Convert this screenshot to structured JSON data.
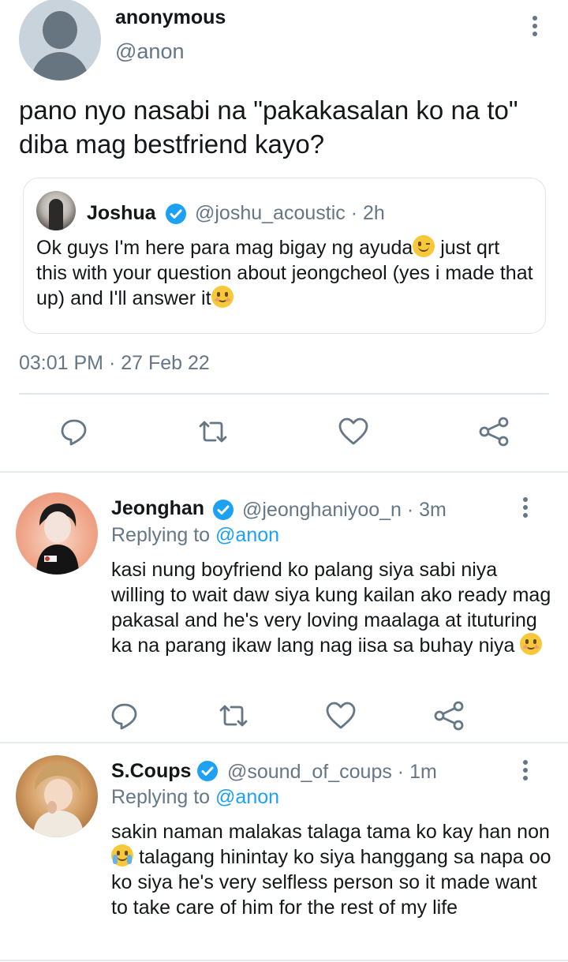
{
  "main_tweet": {
    "author_name": "anonymous",
    "author_handle": "@anon",
    "text": "pano nyo nasabi na \"pakakasalan ko na to\" diba mag bestfriend kayo?",
    "timestamp": "03:01 PM · 27 Feb 22",
    "quoted": {
      "name": "Joshua",
      "handle_time": "@joshu_acoustic · 2h",
      "text_part1": "Ok guys I'm here para mag bigay ng ayuda",
      "text_part2": " just qrt this with your question about jeongcheol (yes i made that up) and I'll answer it"
    }
  },
  "replies": [
    {
      "name": "Jeonghan",
      "handle_time": "@jeonghaniyoo_n · 3m",
      "replying_prefix": "Replying to ",
      "replying_mention": "@anon",
      "text": "kasi nung boyfriend ko palang siya sabi niya willing to wait daw siya kung kailan ako ready mag pakasal and he's very loving maalaga at ituturing ka na parang ikaw lang nag iisa sa buhay niya "
    },
    {
      "name": "S.Coups",
      "handle_time": "@sound_of_coups · 1m",
      "replying_prefix": "Replying to ",
      "replying_mention": "@anon",
      "text_part1": "sakin naman malakas talaga tama ko kay han non",
      "text_part2": " talagang hinintay ko siya hanggang sa napa oo ko siya he's very selfless person so it made want to take care of him for the rest of my life"
    }
  ],
  "icons": {
    "reply": "reply-icon",
    "retweet": "retweet-icon",
    "like": "heart-icon",
    "share": "share-icon",
    "more": "more-vertical-icon",
    "verified": "verified-badge-icon"
  },
  "colors": {
    "accent": "#1da1f2",
    "secondary_text": "#657786",
    "icon": "#657786",
    "divider": "#e1e8ed"
  }
}
